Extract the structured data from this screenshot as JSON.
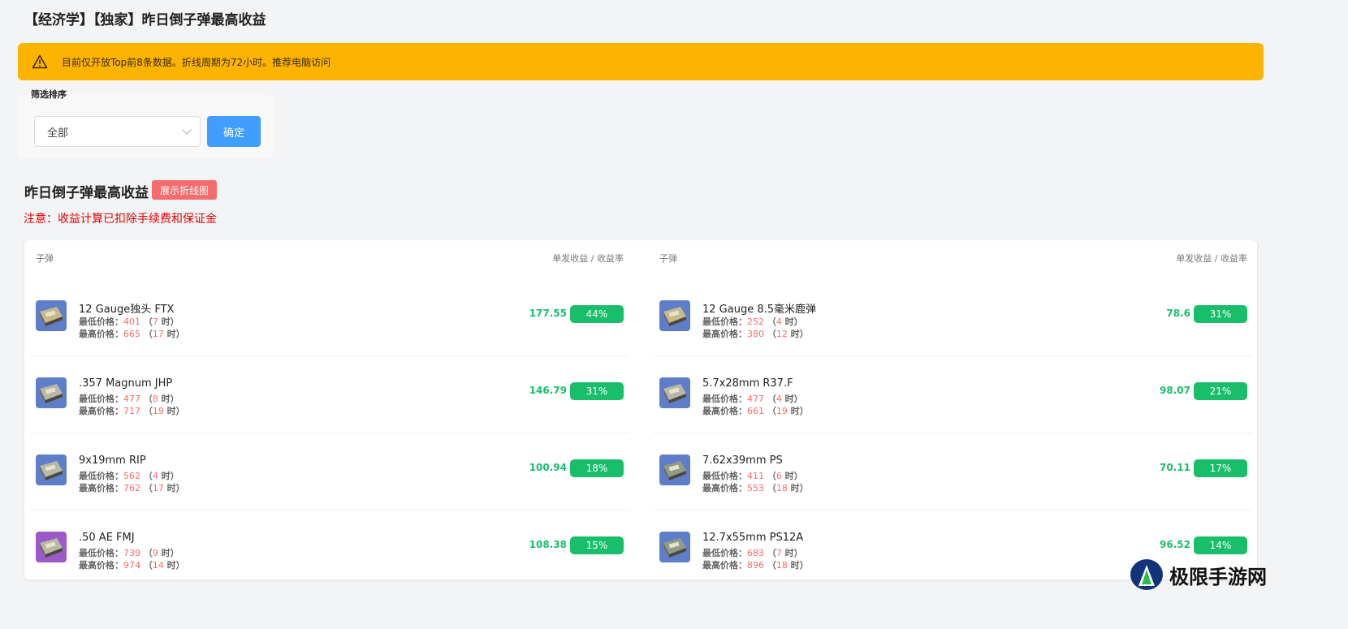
{
  "page": {
    "title": "【经济学】【独家】昨日倒子弹最高收益"
  },
  "alert": {
    "icon": "warning-icon",
    "text": "目前仅开放Top前8条数据。折线周期为72小时。推荐电脑访问",
    "color": "#fdb400"
  },
  "filter": {
    "label": "筛选排序",
    "select_value": "全部",
    "confirm_label": "确定"
  },
  "section": {
    "title": "昨日倒子弹最高收益",
    "chart_button": "展示折线图",
    "note": "注意：收益计算已扣除手续费和保证金"
  },
  "table": {
    "header_left": "子弹",
    "header_right": "单发收益 / 收益率",
    "min_label": "最低价格：",
    "max_label": "最高价格：",
    "left_rows": [
      {
        "name": "12 Gauge独头 FTX",
        "min_price": "401",
        "min_hours": "7",
        "max_price": "665",
        "max_hours": "17",
        "profit": "177.55",
        "rate": "44%",
        "thumb": "shotgun-ammo-box"
      },
      {
        "name": ".357 Magnum JHP",
        "min_price": "477",
        "min_hours": "8",
        "max_price": "717",
        "max_hours": "19",
        "profit": "146.79",
        "rate": "31%",
        "thumb": "pistol-ammo-box"
      },
      {
        "name": "9x19mm RIP",
        "min_price": "562",
        "min_hours": "4",
        "max_price": "762",
        "max_hours": "17",
        "profit": "100.94",
        "rate": "18%",
        "thumb": "pistol-ammo-box"
      },
      {
        "name": ".50 AE FMJ",
        "min_price": "739",
        "min_hours": "9",
        "max_price": "974",
        "max_hours": "14",
        "profit": "108.38",
        "rate": "15%",
        "thumb": "purple-ammo-box"
      }
    ],
    "right_rows": [
      {
        "name": "12 Gauge 8.5毫米鹿弹",
        "min_price": "252",
        "min_hours": "4",
        "max_price": "380",
        "max_hours": "12",
        "profit": "78.6",
        "rate": "31%",
        "thumb": "shotgun-ammo-box"
      },
      {
        "name": "5.7x28mm R37.F",
        "min_price": "477",
        "min_hours": "4",
        "max_price": "661",
        "max_hours": "19",
        "profit": "98.07",
        "rate": "21%",
        "thumb": "pistol-ammo-box"
      },
      {
        "name": "7.62x39mm PS",
        "min_price": "411",
        "min_hours": "6",
        "max_price": "553",
        "max_hours": "18",
        "profit": "70.11",
        "rate": "17%",
        "thumb": "rifle-ammo-box"
      },
      {
        "name": "12.7x55mm PS12A",
        "min_price": "683",
        "min_hours": "7",
        "max_price": "896",
        "max_hours": "18",
        "profit": "96.52",
        "rate": "14%",
        "thumb": "rifle-ammo-box"
      }
    ]
  },
  "watermark": {
    "text": "极限手游网"
  },
  "colors": {
    "accent_blue": "#409eff",
    "positive_green": "#19be6b",
    "price_red": "#f56c6c",
    "note_red": "#e60000"
  }
}
